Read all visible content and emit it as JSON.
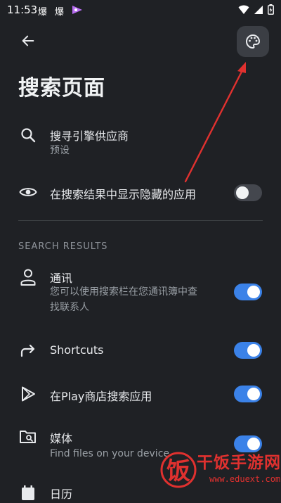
{
  "status_bar": {
    "time": "11:53",
    "notif_1": "爆",
    "notif_2": "爆"
  },
  "header": {
    "back_icon": "arrow-left-icon",
    "palette_icon": "palette-icon"
  },
  "page_title": "搜索页面",
  "settings": {
    "search_engine": {
      "icon": "search-icon",
      "title": "搜寻引擎供应商",
      "subtitle": "预设"
    },
    "show_hidden": {
      "icon": "eye-icon",
      "title": "在搜索结果中显示隐藏的应用",
      "enabled": false
    }
  },
  "search_results": {
    "header": "SEARCH RESULTS",
    "items": [
      {
        "icon": "person-icon",
        "title": "通讯",
        "subtitle_line1": "您可以使用搜索栏在您通讯簿中查",
        "subtitle_line2": "找联系人",
        "enabled": true
      },
      {
        "icon": "share-arrow-icon",
        "title": "Shortcuts",
        "enabled": true
      },
      {
        "icon": "play-store-icon",
        "title": "在Play商店搜索应用",
        "enabled": true
      },
      {
        "icon": "folder-search-icon",
        "title": "媒体",
        "subtitle": "Find files on your device",
        "enabled": true
      },
      {
        "icon": "calendar-icon",
        "title": "日历"
      }
    ]
  },
  "colors": {
    "background": "#1f2125",
    "toggle_on": "#3b82e8",
    "toggle_off": "#44474e",
    "annotation_red": "#e0312f"
  },
  "watermark": {
    "logo_char": "饭",
    "text": "干饭手游网",
    "url": "www.eduext.com"
  }
}
